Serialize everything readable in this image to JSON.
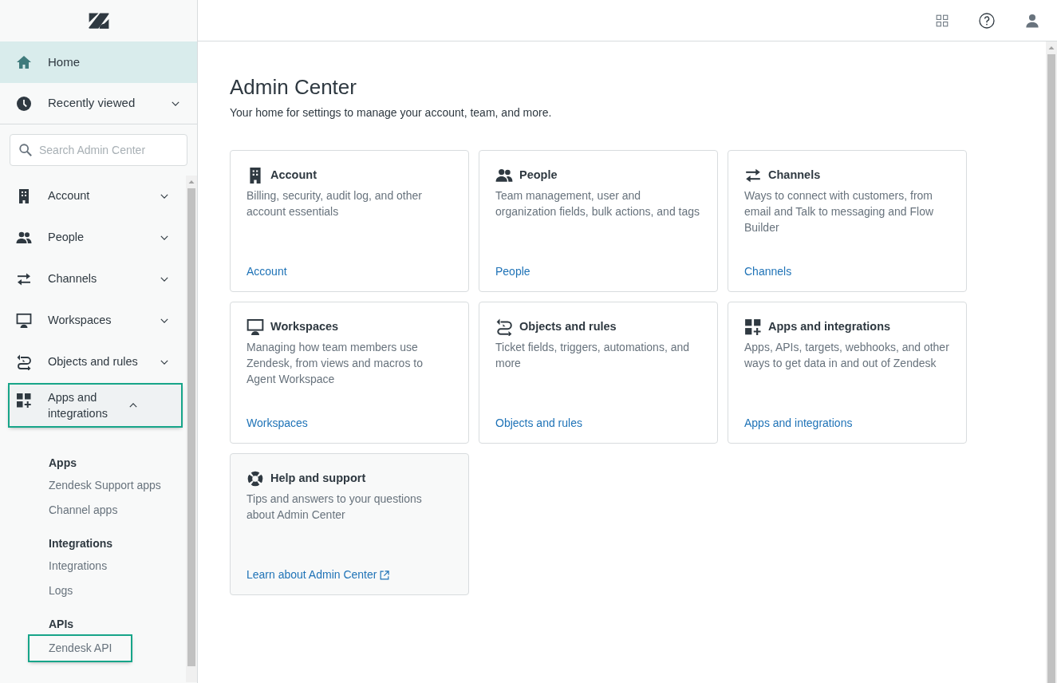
{
  "sidebar": {
    "top_items": [
      {
        "kind": "link",
        "label": "Home",
        "selected": true
      },
      {
        "kind": "menu",
        "label": "Recently viewed",
        "selected": false,
        "expanded": false
      }
    ],
    "search": {
      "placeholder": "Search Admin Center"
    },
    "nav_items": [
      {
        "label": "Account",
        "expanded": false,
        "highlighted": false
      },
      {
        "label": "People",
        "expanded": false,
        "highlighted": false
      },
      {
        "label": "Channels",
        "expanded": false,
        "highlighted": false
      },
      {
        "label": "Workspaces",
        "expanded": false,
        "highlighted": false
      },
      {
        "label": "Objects and rules",
        "expanded": false,
        "highlighted": false
      },
      {
        "label": "Apps and integrations",
        "expanded": true,
        "highlighted": true,
        "children": [
          {
            "label": "Apps",
            "children": [
              {
                "label": "Zendesk Support apps",
                "highlighted": false
              },
              {
                "label": "Channel apps",
                "highlighted": false
              }
            ]
          },
          {
            "label": "Integrations",
            "children": [
              {
                "label": "Integrations",
                "highlighted": false
              },
              {
                "label": "Logs",
                "highlighted": false
              }
            ]
          },
          {
            "label": "APIs",
            "children": [
              {
                "label": "Zendesk API",
                "highlighted": true
              }
            ]
          }
        ]
      }
    ]
  },
  "main": {
    "title": "Admin Center",
    "subtitle": "Your home for settings to manage your account, team, and more.",
    "cards": [
      {
        "kind": "section",
        "title": "Account",
        "description": "Billing, security, audit log, and other account essentials",
        "link": "Account"
      },
      {
        "kind": "section",
        "title": "People",
        "description": "Team management, user and organization fields, bulk actions, and tags",
        "link": "People"
      },
      {
        "kind": "section",
        "title": "Channels",
        "description": "Ways to connect with customers, from email and Talk to messaging and Flow Builder",
        "link": "Channels"
      },
      {
        "kind": "section",
        "title": "Workspaces",
        "description": "Managing how team members use Zendesk, from views and macros to Agent Workspace",
        "link": "Workspaces"
      },
      {
        "kind": "section",
        "title": "Objects and rules",
        "description": "Ticket fields, triggers, automations, and more",
        "link": "Objects and rules"
      },
      {
        "kind": "section",
        "title": "Apps and integrations",
        "description": "Apps, APIs, targets, webhooks, and other ways to get data in and out of Zendesk",
        "link": "Apps and integrations"
      },
      {
        "kind": "help",
        "title": "Help and support",
        "description": "Tips and answers to your questions about Admin Center",
        "link": "Learn about Admin Center"
      }
    ]
  }
}
